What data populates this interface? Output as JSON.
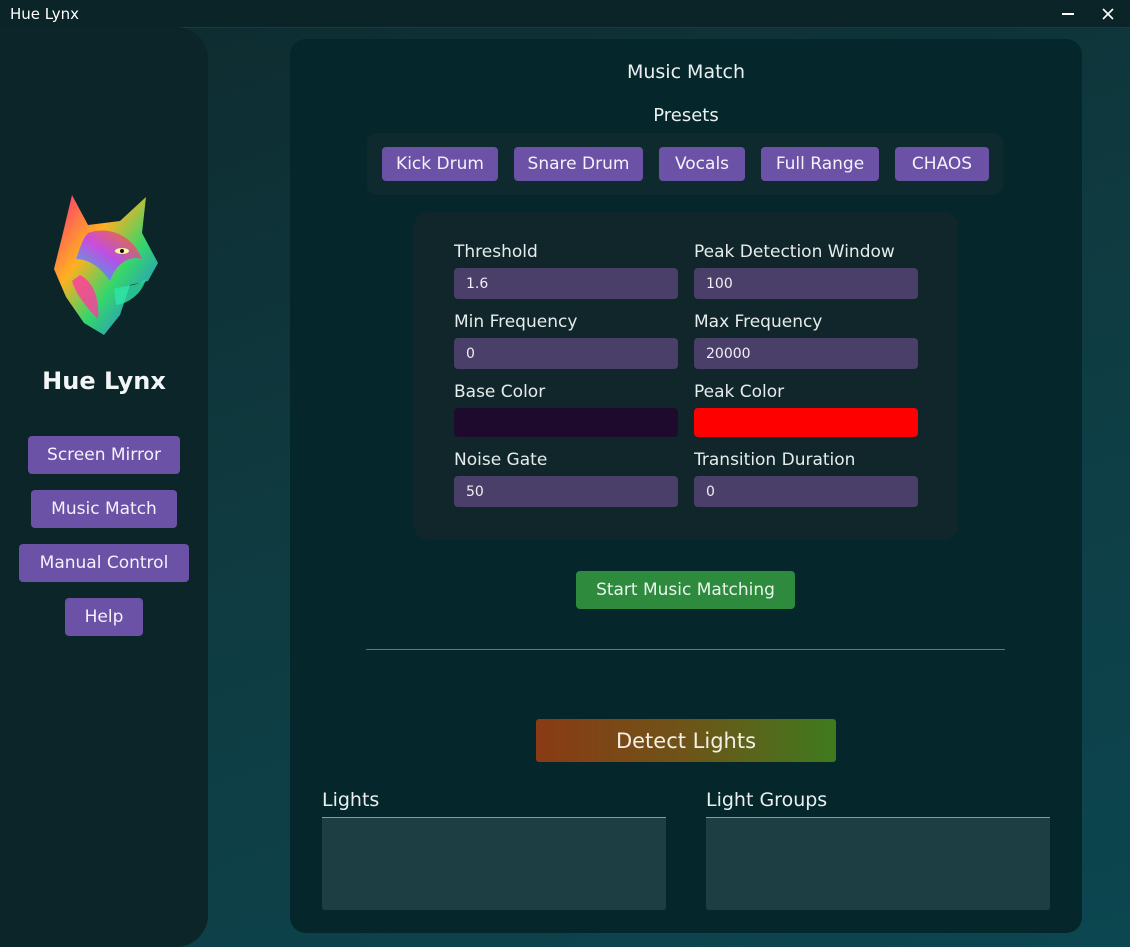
{
  "window": {
    "title": "Hue Lynx",
    "minimize_icon": "minimize-icon",
    "close_icon": "close-icon"
  },
  "sidebar": {
    "app_name": "Hue Lynx",
    "logo": "lynx-logo",
    "nav": [
      {
        "label": "Screen Mirror"
      },
      {
        "label": "Music Match"
      },
      {
        "label": "Manual Control"
      },
      {
        "label": "Help"
      }
    ]
  },
  "main": {
    "title": "Music Match",
    "presets_title": "Presets",
    "presets": [
      {
        "label": "Kick Drum"
      },
      {
        "label": "Snare Drum"
      },
      {
        "label": "Vocals"
      },
      {
        "label": "Full Range"
      },
      {
        "label": "CHAOS"
      }
    ],
    "fields": {
      "threshold": {
        "label": "Threshold",
        "value": "1.6"
      },
      "peak_window": {
        "label": "Peak Detection Window",
        "value": "100"
      },
      "min_freq": {
        "label": "Min Frequency",
        "value": "0"
      },
      "max_freq": {
        "label": "Max Frequency",
        "value": "20000"
      },
      "base_color": {
        "label": "Base Color",
        "color": "#1e0a2c"
      },
      "peak_color": {
        "label": "Peak Color",
        "color": "#ff0000"
      },
      "noise_gate": {
        "label": "Noise Gate",
        "value": "50"
      },
      "transition": {
        "label": "Transition Duration",
        "value": "0"
      }
    },
    "start_button": "Start Music Matching",
    "detect_button": "Detect Lights",
    "lights_label": "Lights",
    "groups_label": "Light Groups"
  },
  "colors": {
    "accent_purple": "#6b52a6",
    "start_green": "#2e8b3e",
    "input_bg": "#4a3f68"
  }
}
